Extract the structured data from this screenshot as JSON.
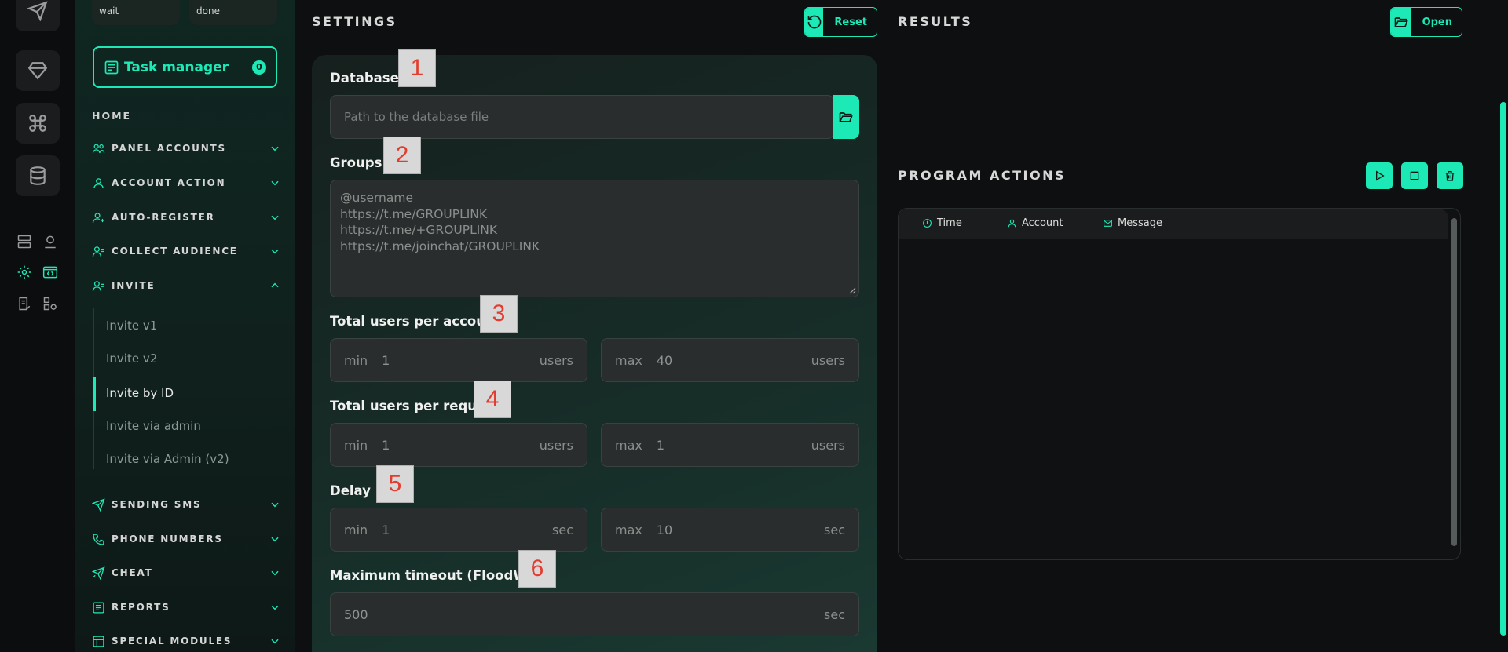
{
  "colors": {
    "accent": "#1de9b6",
    "marker_text": "#e23c2f"
  },
  "rail": {
    "icons": [
      "send-icon",
      "diamond-icon",
      "command-icon",
      "database-icon",
      "server-list-icon",
      "user-pin-icon",
      "settings-icon",
      "code-window-icon",
      "checklist-icon",
      "shapes-icon"
    ]
  },
  "sidebar": {
    "chips": [
      "wait",
      "done"
    ],
    "task_manager": {
      "label": "Task manager",
      "count": "0"
    },
    "home": "HOME",
    "items": [
      {
        "label": "PANEL ACCOUNTS",
        "icon": "users-icon"
      },
      {
        "label": "ACCOUNT ACTION",
        "icon": "user-icon"
      },
      {
        "label": "AUTO-REGISTER",
        "icon": "user-plus-icon"
      },
      {
        "label": "COLLECT AUDIENCE",
        "icon": "user-list-icon"
      },
      {
        "label": "INVITE",
        "icon": "user-invite-icon"
      },
      {
        "label": "SENDING SMS",
        "icon": "send-icon"
      },
      {
        "label": "PHONE NUMBERS",
        "icon": "phone-icon"
      },
      {
        "label": "CHEAT",
        "icon": "boost-icon"
      },
      {
        "label": "REPORTS",
        "icon": "report-icon"
      },
      {
        "label": "SPECIAL MODULES",
        "icon": "module-icon"
      }
    ],
    "invite_sub": [
      "Invite v1",
      "Invite v2",
      "Invite by ID",
      "Invite via admin",
      "Invite via Admin (v2)"
    ],
    "active_sub": "Invite by ID"
  },
  "settings": {
    "title": "SETTINGS",
    "reset_label": "Reset",
    "database": {
      "label": "Database",
      "placeholder": "Path to the database file",
      "marker": "1"
    },
    "groups": {
      "label": "Groups",
      "marker": "2",
      "lines": [
        "@username",
        "https://t.me/GROUPLINK",
        "https://t.me/+GROUPLINK",
        "https://t.me/joinchat/GROUPLINK"
      ]
    },
    "users_per_account": {
      "label": "Total users per account",
      "marker": "3",
      "min_prefix": "min",
      "min": "1",
      "max_prefix": "max",
      "max": "40",
      "unit": "users"
    },
    "users_per_request": {
      "label": "Total users per request",
      "marker": "4",
      "min_prefix": "min",
      "min": "1",
      "max_prefix": "max",
      "max": "1",
      "unit": "users"
    },
    "delay": {
      "label": "Delay",
      "marker": "5",
      "min_prefix": "min",
      "min": "1",
      "max_prefix": "max",
      "max": "10",
      "unit": "sec"
    },
    "timeout": {
      "label": "Maximum timeout (FloodWait)",
      "marker": "6",
      "value": "500",
      "unit": "sec"
    }
  },
  "results": {
    "title": "RESULTS",
    "open_label": "Open"
  },
  "program_actions": {
    "title": "PROGRAM ACTIONS",
    "buttons": [
      "play-icon",
      "stop-icon",
      "trash-icon"
    ],
    "columns": [
      {
        "label": "Time",
        "icon": "clock-icon"
      },
      {
        "label": "Account",
        "icon": "user-icon"
      },
      {
        "label": "Message",
        "icon": "mail-icon"
      }
    ]
  }
}
